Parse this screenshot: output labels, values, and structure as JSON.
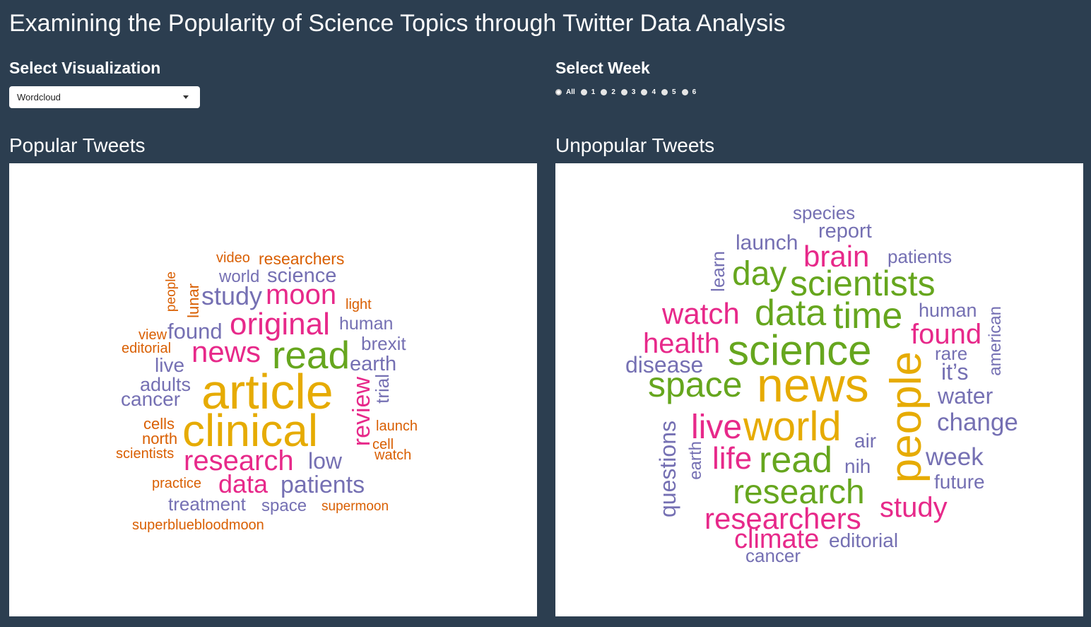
{
  "app_title": "Examining the Popularity of Science Topics through Twitter Data Analysis",
  "controls": {
    "visualization_label": "Select Visualization",
    "visualization_value": "Wordcloud",
    "week_label": "Select Week",
    "week_options": [
      "All",
      "1",
      "2",
      "3",
      "4",
      "5",
      "6"
    ],
    "week_selected": "All"
  },
  "colors": {
    "background": "#2c3e50",
    "orange": "#d95f02",
    "purple": "#7570b3",
    "pink": "#e7298a",
    "green": "#66a61e",
    "gold": "#e6ab02"
  },
  "popular": {
    "title": "Popular Tweets",
    "words": [
      "video",
      "researchers",
      "world",
      "science",
      "people",
      "lunar",
      "study",
      "moon",
      "light",
      "view",
      "found",
      "original",
      "human",
      "editorial",
      "news",
      "read",
      "brexit",
      "live",
      "earth",
      "adults",
      "article",
      "review",
      "trial",
      "cancer",
      "cells",
      "clinical",
      "launch",
      "north",
      "cell",
      "scientists",
      "research",
      "low",
      "watch",
      "practice",
      "data",
      "patients",
      "treatment",
      "space",
      "supermoon",
      "superbluebloodmoon"
    ]
  },
  "unpopular": {
    "title": "Unpopular Tweets",
    "words": [
      "species",
      "report",
      "launch",
      "brain",
      "patients",
      "learn",
      "day",
      "scientists",
      "watch",
      "data",
      "time",
      "human",
      "american",
      "found",
      "health",
      "science",
      "rare",
      "disease",
      "it’s",
      "space",
      "news",
      "people",
      "water",
      "change",
      "questions",
      "live",
      "world",
      "air",
      "earth",
      "life",
      "read",
      "week",
      "nih",
      "future",
      "research",
      "study",
      "researchers",
      "climate",
      "editorial",
      "cancer"
    ]
  }
}
